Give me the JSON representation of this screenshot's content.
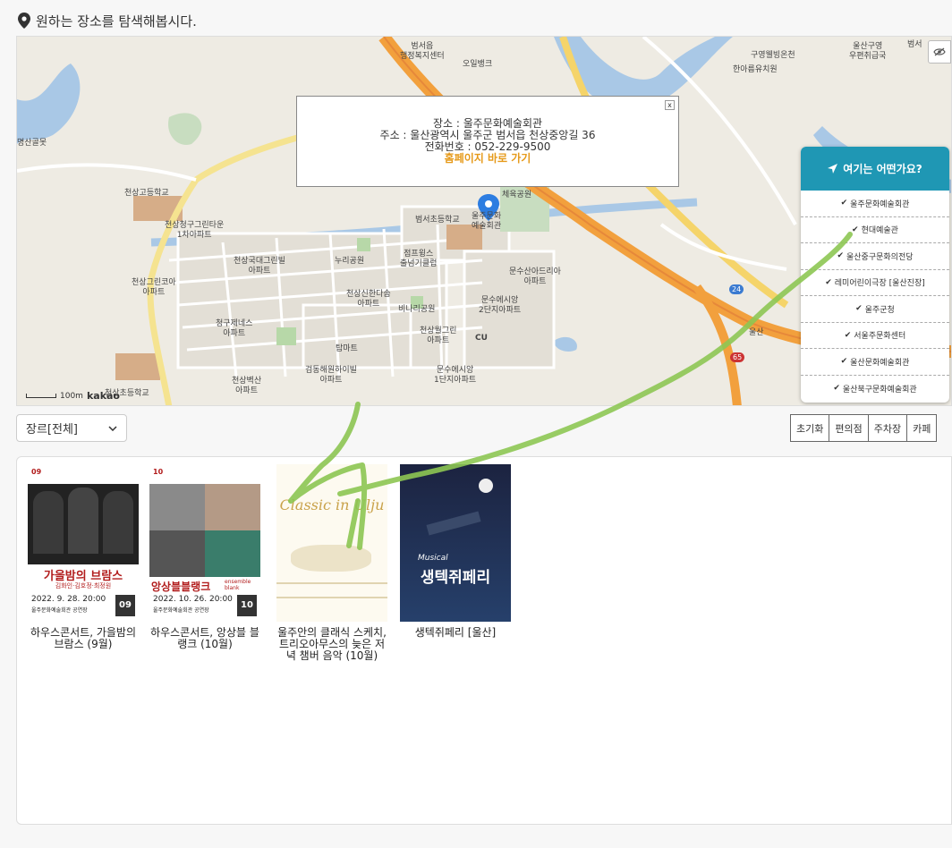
{
  "header": {
    "title": "원하는 장소를 탐색해봅시다."
  },
  "map": {
    "popup": {
      "place_line": "장소 : 울주문화예술회관",
      "address_line": "주소 : 울산광역시 울주군 범서읍 천상중앙길 36",
      "phone_line": "전화번호 : 052-229-9500",
      "homepage_link": "홈페이지 바로 가기",
      "close_label": "x"
    },
    "labels": {
      "l1": "범서읍\n행정복지센터",
      "l2": "오일뱅크",
      "l3": "구영웰빙온천",
      "l4": "한아름유치원",
      "l5": "울산구영\n우편취급국",
      "l6": "범서",
      "l7": "천상고등학교",
      "l8": "천상청구그린타운\n1차아파트",
      "l9": "천상국대그린빌\n아파트",
      "l10": "누리공원",
      "l11": "점프윙스\n출넘기클럽",
      "l12": "천상그린코아\n아파트",
      "l13": "천상신한다솜\n아파트",
      "l14": "비나리공원",
      "l15": "청구제네스\n아파트",
      "l16": "천상월그린\n아파트",
      "l17": "탑마트",
      "l18": "검동해원하이빌\n아파트",
      "l19": "문수산아드리아\n아파트",
      "l20": "문수에시앙\n2단지아파트",
      "l21": "문수에시앙\n1단지아파트",
      "l22": "천상벽산\n아파트",
      "l23": "천상초등학교",
      "l24": "범서초등학교",
      "l25": "울주문화\n예술회관",
      "l26": "체육공원",
      "l27": "CU",
      "l28": "명산골못",
      "l29": "울산",
      "road1": "24",
      "road2": "65"
    },
    "scale_label": "100m",
    "logo": "kakao"
  },
  "place_panel": {
    "header": "여기는 어떤가요?",
    "items": [
      "울주문화예술회관",
      "현대예술관",
      "울산중구문화의전당",
      "레미어린이극장 [울산진장]",
      "울주군청",
      "서울주문화센터",
      "울산문화예술회관",
      "울산북구문화예술회관"
    ]
  },
  "filter": {
    "genre_selected": "장르[전체]"
  },
  "category_buttons": [
    "초기화",
    "편의점",
    "주차장",
    "카페"
  ],
  "results": [
    {
      "title": "하우스콘서트, 가을밤의 브람스 (9월)",
      "poster_title": "가을밤의 브람스",
      "poster_sub": "김화인·김호정·최정원",
      "poster_date": "2022. 9. 28. 20:00",
      "poster_venue": "울주문화예술회관 공연장",
      "poster_badge": "09",
      "poster_tag": "09",
      "poster_colors": [
        "#b21d1d",
        "#1a1a1a"
      ]
    },
    {
      "title": "하우스콘서트, 앙상블 블랭크 (10월)",
      "poster_title": "앙상블블랭크",
      "poster_sub": "ensemble blank",
      "poster_date": "2022. 10. 26. 20:00",
      "poster_venue": "울주문화예술회관 공연장",
      "poster_badge": "10",
      "poster_tag": "10",
      "poster_colors": [
        "#b21d1d",
        "#1a1a1a"
      ]
    },
    {
      "title": "울주안의 클래식 스케치, 트리오아무스의 늦은 저녁 챔버 음악 (10월)",
      "poster_title": "Classic in Ulju",
      "poster_colors": [
        "#c9a24a",
        "#fdfaf0"
      ]
    },
    {
      "title": "생텍쥐페리 [울산]",
      "poster_title": "생텍쥐페리",
      "poster_sub": "Musical",
      "poster_colors": [
        "#1b2a4a",
        "#fff"
      ]
    }
  ]
}
